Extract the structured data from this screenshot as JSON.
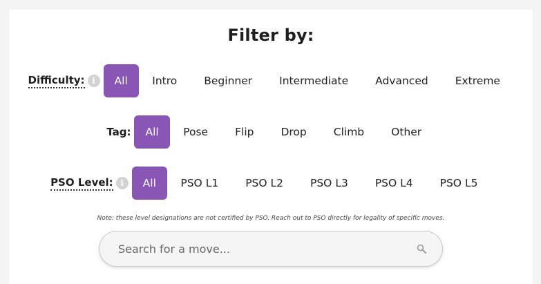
{
  "header": {
    "title": "Filter by:"
  },
  "difficulty": {
    "label": "Difficulty:",
    "info_icon": "info-icon",
    "options": [
      "All",
      "Intro",
      "Beginner",
      "Intermediate",
      "Advanced",
      "Extreme"
    ],
    "selected": "All"
  },
  "tag": {
    "label": "Tag:",
    "options": [
      "All",
      "Pose",
      "Flip",
      "Drop",
      "Climb",
      "Other"
    ],
    "selected": "All"
  },
  "pso_level": {
    "label": "PSO Level:",
    "info_icon": "info-icon",
    "options": [
      "All",
      "PSO L1",
      "PSO L2",
      "PSO L3",
      "PSO L4",
      "PSO L5"
    ],
    "selected": "All"
  },
  "note": "Note: these level designations are not certified by PSO. Reach out to PSO directly for legality of specific moves.",
  "search": {
    "placeholder": "Search for a move...",
    "value": "",
    "icon": "search-icon"
  },
  "colors": {
    "accent": "#8a56b5",
    "info_icon": "#d3d3d3",
    "background": "#f4f4f4"
  }
}
